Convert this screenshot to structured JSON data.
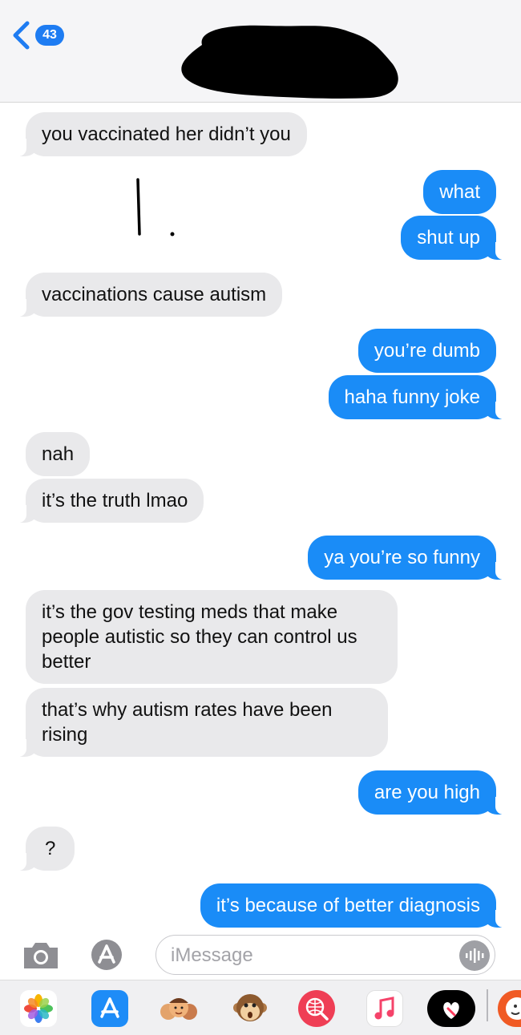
{
  "header": {
    "unread_count": "43"
  },
  "messages": [
    {
      "dir": "in",
      "text": "you vaccinated her didn’t you"
    },
    {
      "dir": "out",
      "text": "what"
    },
    {
      "dir": "out",
      "text": "shut up"
    },
    {
      "dir": "in",
      "text": "vaccinations cause autism"
    },
    {
      "dir": "out",
      "text": "you’re dumb"
    },
    {
      "dir": "out",
      "text": "haha funny joke"
    },
    {
      "dir": "in",
      "text": "nah"
    },
    {
      "dir": "in",
      "text": "it’s the truth lmao"
    },
    {
      "dir": "out",
      "text": "ya you’re so funny"
    },
    {
      "dir": "in",
      "text": "it’s the gov testing meds that make people autistic so they can control us better"
    },
    {
      "dir": "in",
      "text": "that’s why autism rates have been rising"
    },
    {
      "dir": "out",
      "text": "are you high"
    },
    {
      "dir": "in",
      "text": "?"
    },
    {
      "dir": "out",
      "text": "it’s because of better diagnosis"
    }
  ],
  "compose": {
    "placeholder": "iMessage"
  },
  "app_drawer": [
    "photos-app",
    "app-store-app",
    "memoji-app",
    "animoji-app",
    "search-images-app",
    "music-app",
    "digital-touch-app",
    "sticker-app"
  ],
  "colors": {
    "outgoing": "#1a8cf7",
    "incoming": "#e9e9eb",
    "badge": "#1e7cf2"
  }
}
